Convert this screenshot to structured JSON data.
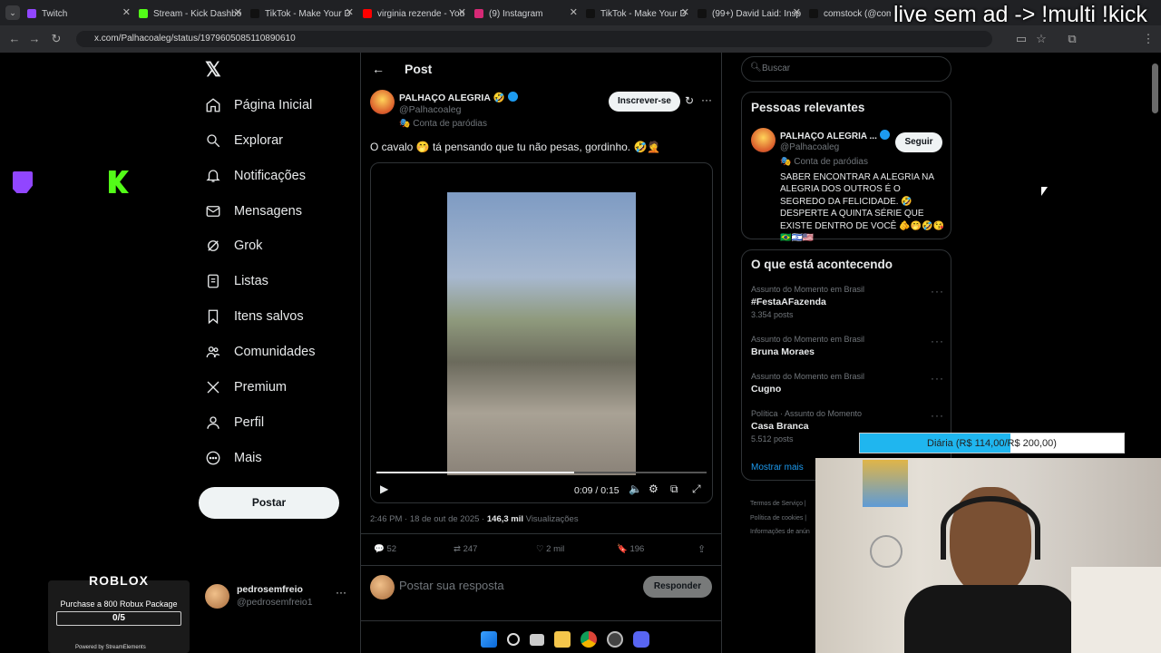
{
  "browser": {
    "tabs": [
      {
        "title": "Twitch",
        "color": "#9146ff"
      },
      {
        "title": "Stream - Kick Dashbo",
        "color": "#53fc18"
      },
      {
        "title": "TikTok - Make Your D",
        "color": "#111111"
      },
      {
        "title": "virginia rezende - You",
        "color": "#ff0000"
      },
      {
        "title": "(9) Instagram",
        "color": "#d62976"
      },
      {
        "title": "TikTok - Make Your D",
        "color": "#111111"
      },
      {
        "title": "(99+) David Laid: Insp",
        "color": "#111111"
      },
      {
        "title": "comstock (@comsto",
        "color": "#111111"
      }
    ],
    "url": "x.com/Palhacoaleg/status/1979605085110890610"
  },
  "overlay": {
    "top_text": "live sem ad -> !multi !kick"
  },
  "left_nav": {
    "items": [
      {
        "label": "Página Inicial",
        "icon": "home-icon"
      },
      {
        "label": "Explorar",
        "icon": "search-icon"
      },
      {
        "label": "Notificações",
        "icon": "bell-icon"
      },
      {
        "label": "Mensagens",
        "icon": "mail-icon"
      },
      {
        "label": "Grok",
        "icon": "grok-icon"
      },
      {
        "label": "Listas",
        "icon": "list-icon"
      },
      {
        "label": "Itens salvos",
        "icon": "bookmark-icon"
      },
      {
        "label": "Comunidades",
        "icon": "people-icon"
      },
      {
        "label": "Premium",
        "icon": "x-logo-icon"
      },
      {
        "label": "Perfil",
        "icon": "person-icon"
      },
      {
        "label": "Mais",
        "icon": "more-circle-icon"
      }
    ],
    "post_button": "Postar",
    "account": {
      "name": "pedrosemfreio",
      "handle": "@pedrosemfreio1"
    }
  },
  "post": {
    "header": "Post",
    "author_name": "PALHAÇO ALEGRIA 🤣",
    "author_handle": "@Palhacoaleg",
    "parody_label": "Conta de paródias",
    "subscribe_button": "Inscrever-se",
    "text": "O cavalo 🤭 tá pensando que tu não pesas, gordinho. 🤣🤦",
    "video": {
      "time": "0:09 / 0:15",
      "progress": 0.6
    },
    "timestamp": "2:46 PM · 18 de out de 2025 ·",
    "views_count": "146,3 mil",
    "views_label": "Visualizações",
    "stats": {
      "replies": "52",
      "reposts": "247",
      "likes": "2 mil",
      "bookmarks": "196"
    },
    "reply_placeholder": "Postar sua resposta",
    "reply_button": "Responder"
  },
  "right": {
    "search_placeholder": "Buscar",
    "relevant": {
      "title": "Pessoas relevantes",
      "name": "PALHAÇO ALEGRIA ...",
      "handle": "@Palhacoaleg",
      "parody_label": "Conta de paródias",
      "follow_button": "Seguir",
      "bio": "SABER ENCONTRAR A ALEGRIA NA ALEGRIA DOS OUTROS É O SEGREDO DA FELICIDADE. 🤣 DESPERTE A QUINTA SÉRIE QUE EXISTE DENTRO DE VOCÊ 🫵🤭🤣😘🇧🇷🇮🇱🇺🇸"
    },
    "trends": {
      "title": "O que está acontecendo",
      "items": [
        {
          "category": "Assunto do Momento em Brasil",
          "name": "#FestaAFazenda",
          "posts": "3.354 posts"
        },
        {
          "category": "Assunto do Momento em Brasil",
          "name": "Bruna Moraes",
          "posts": ""
        },
        {
          "category": "Assunto do Momento em Brasil",
          "name": "Cugno",
          "posts": ""
        },
        {
          "category": "Política · Assunto do Momento",
          "name": "Casa Branca",
          "posts": "5.512 posts"
        }
      ],
      "show_more": "Mostrar mais"
    },
    "footer": {
      "line1": "Termos de Serviço |",
      "line2": "Política de cookies |",
      "line3": "Informações de anún"
    }
  },
  "stream": {
    "goal_bar": {
      "label": "Diária (R$ 114,00/R$ 200,00)",
      "progress": 0.57
    },
    "roblox": {
      "logo": "ROBLOX",
      "text": "Purchase a 800 Robux Package",
      "count": "0/5",
      "powered": "Powered by StreamElements"
    }
  }
}
